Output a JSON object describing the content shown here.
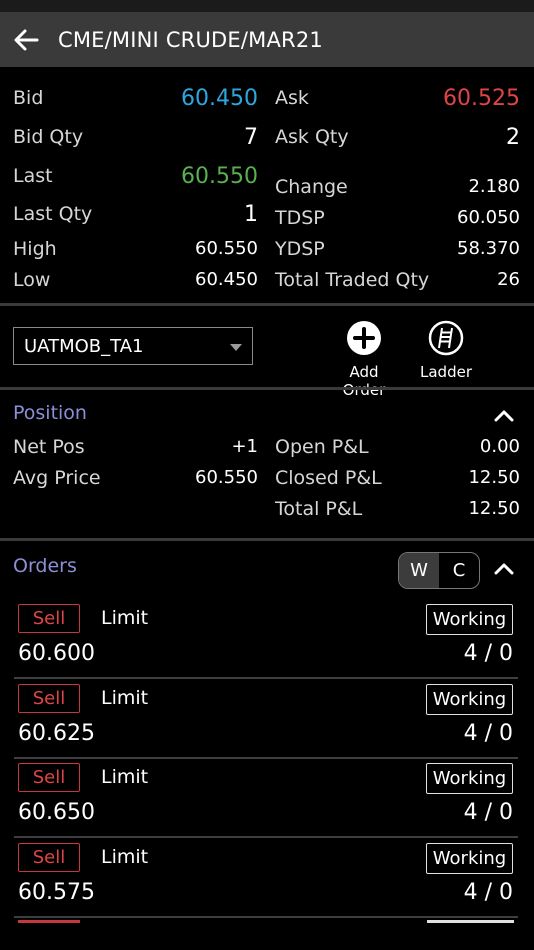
{
  "header": {
    "title": "CME/MINI CRUDE/MAR21"
  },
  "quote": {
    "bid_label": "Bid",
    "bid": "60.450",
    "ask_label": "Ask",
    "ask": "60.525",
    "bid_qty_label": "Bid Qty",
    "bid_qty": "7",
    "ask_qty_label": "Ask Qty",
    "ask_qty": "2",
    "last_label": "Last",
    "last": "60.550",
    "change_label": "Change",
    "change": "2.180",
    "last_qty_label": "Last Qty",
    "last_qty": "1",
    "tdsp_label": "TDSP",
    "tdsp": "60.050",
    "high_label": "High",
    "high": "60.550",
    "ydsp_label": "YDSP",
    "ydsp": "58.370",
    "low_label": "Low",
    "low": "60.450",
    "total_traded_label": "Total Traded Qty",
    "total_traded": "26"
  },
  "account": {
    "selected": "UATMOB_TA1"
  },
  "actions": {
    "add_order": "Add Order",
    "ladder": "Ladder"
  },
  "position": {
    "title": "Position",
    "net_pos_label": "Net Pos",
    "net_pos": "+1",
    "open_pl_label": "Open P&L",
    "open_pl": "0.00",
    "avg_price_label": "Avg Price",
    "avg_price": "60.550",
    "closed_pl_label": "Closed P&L",
    "closed_pl": "12.50",
    "total_pl_label": "Total P&L",
    "total_pl": "12.50"
  },
  "orders": {
    "title": "Orders",
    "toggle": {
      "w": "W",
      "c": "C"
    },
    "items": [
      {
        "side": "Sell",
        "type": "Limit",
        "status": "Working",
        "price": "60.600",
        "qty": "4 / 0"
      },
      {
        "side": "Sell",
        "type": "Limit",
        "status": "Working",
        "price": "60.625",
        "qty": "4 / 0"
      },
      {
        "side": "Sell",
        "type": "Limit",
        "status": "Working",
        "price": "60.650",
        "qty": "4 / 0"
      },
      {
        "side": "Sell",
        "type": "Limit",
        "status": "Working",
        "price": "60.575",
        "qty": "4 / 0"
      }
    ]
  },
  "colors": {
    "bid": "#2ea7e0",
    "ask": "#e04545",
    "last": "#59b04f",
    "section_title": "#8c8fd6"
  }
}
